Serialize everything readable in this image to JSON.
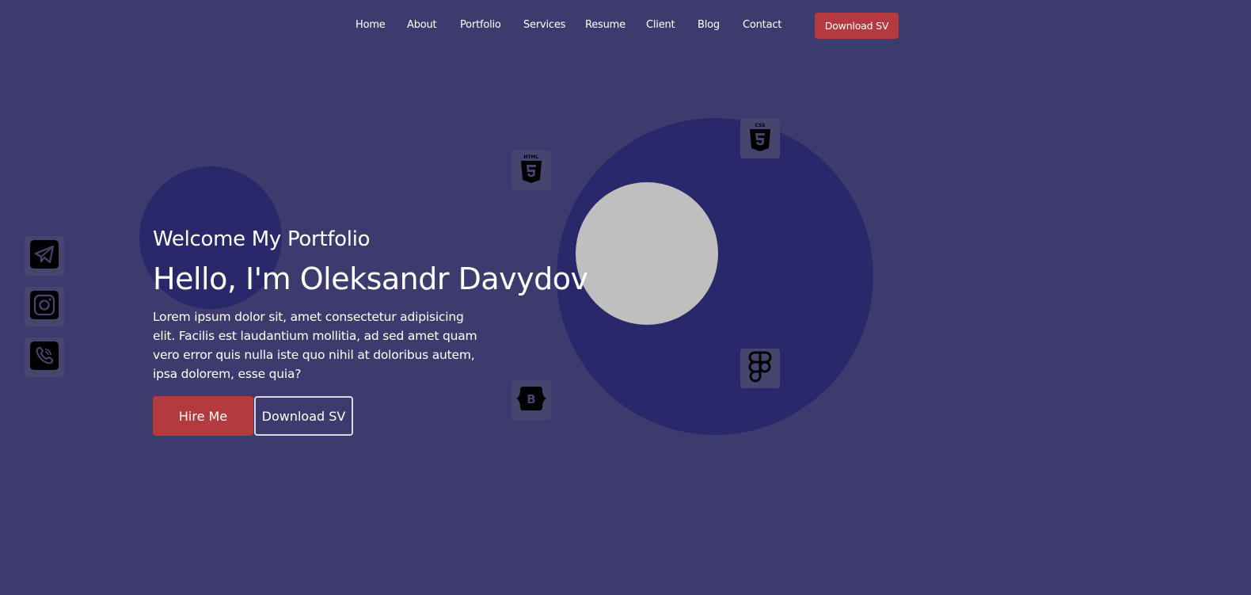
{
  "nav": {
    "items": [
      {
        "label": "Home"
      },
      {
        "label": "About"
      },
      {
        "label": "Portfolio"
      },
      {
        "label": "Services"
      },
      {
        "label": "Resume"
      },
      {
        "label": "Client"
      },
      {
        "label": "Blog"
      },
      {
        "label": "Contact"
      }
    ],
    "cta_label": "Download SV"
  },
  "social": [
    {
      "icon": "telegram-icon"
    },
    {
      "icon": "instagram-icon"
    },
    {
      "icon": "viber-icon"
    }
  ],
  "hero": {
    "subtitle": "Welcome My Portfolio",
    "title": "Hello, I'm Oleksandr Davydov",
    "description": "Lorem ipsum dolor sit, amet consectetur adipisicing elit. Facilis est laudantium mollitia, ad sed amet quam vero error quis nulla iste quo nihil at doloribus autem, ipsa dolorem, esse quia?",
    "hire_label": "Hire Me",
    "download_label": "Download SV"
  },
  "tech_icons": [
    {
      "icon": "html5-icon"
    },
    {
      "icon": "css3-icon"
    },
    {
      "icon": "figma-icon"
    },
    {
      "icon": "bootstrap-icon"
    }
  ],
  "colors": {
    "background": "#3d3b6d",
    "accent": "#b53a3f",
    "circle": "#29286a",
    "avatar_placeholder": "#bfbfbf"
  }
}
